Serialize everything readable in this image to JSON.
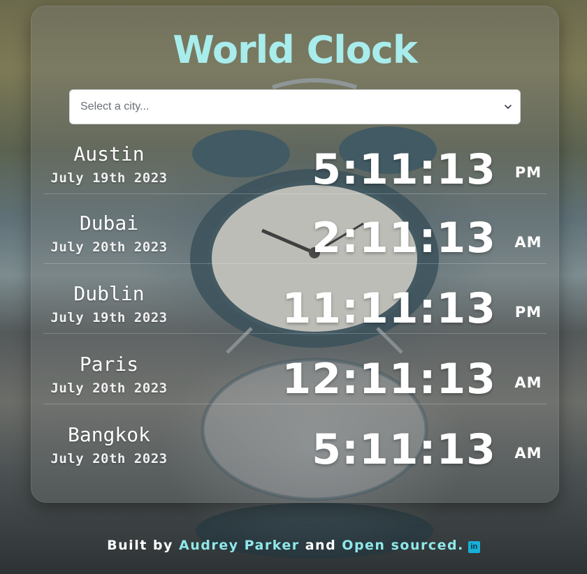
{
  "app": {
    "title": "World Clock"
  },
  "search": {
    "placeholder": "Select a city..."
  },
  "clocks": [
    {
      "city": "Austin",
      "date": "July 19th 2023",
      "time": "5:11:13",
      "ampm": "PM"
    },
    {
      "city": "Dubai",
      "date": "July 20th 2023",
      "time": "2:11:13",
      "ampm": "AM"
    },
    {
      "city": "Dublin",
      "date": "July 19th 2023",
      "time": "11:11:13",
      "ampm": "PM"
    },
    {
      "city": "Paris",
      "date": "July 20th 2023",
      "time": "12:11:13",
      "ampm": "AM"
    },
    {
      "city": "Bangkok",
      "date": "July 20th 2023",
      "time": "5:11:13",
      "ampm": "AM"
    }
  ],
  "footer": {
    "prefix": "Built by",
    "author": "Audrey Parker",
    "middle": "and",
    "link": "Open sourced.",
    "icon": "linkedin-icon",
    "icon_glyph": "in"
  },
  "colors": {
    "title": "#a8ecec",
    "link": "#8fe8ea",
    "linkedin": "#16b0d8"
  }
}
